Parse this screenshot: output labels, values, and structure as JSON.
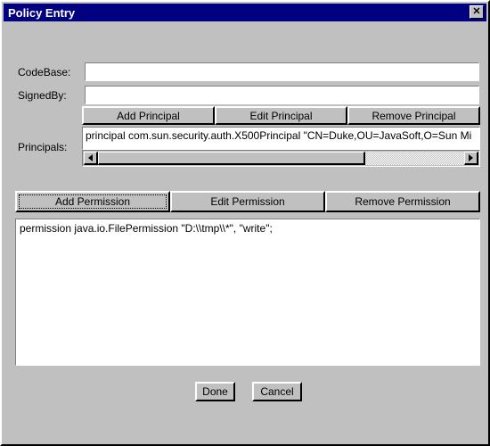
{
  "window": {
    "title": "Policy Entry",
    "close_label": "✕"
  },
  "form": {
    "codebase_label": "CodeBase:",
    "codebase_value": "",
    "codebase_placeholder": "",
    "signedby_label": "SignedBy:",
    "signedby_value": "",
    "signedby_placeholder": "",
    "principals_label": "Principals:"
  },
  "principal_buttons": {
    "add": "Add Principal",
    "edit": "Edit Principal",
    "remove": "Remove Principal"
  },
  "principals_list": [
    "principal com.sun.security.auth.X500Principal \"CN=Duke,OU=JavaSoft,O=Sun Mi"
  ],
  "principals_scrollbar": {
    "left_arrow": "◀",
    "right_arrow": "▶",
    "thumb_percent": 73
  },
  "permission_buttons": {
    "add": "Add Permission",
    "edit": "Edit Permission",
    "remove": "Remove Permission",
    "focused": "add"
  },
  "permissions_list": [
    "permission java.io.FilePermission \"D:\\\\tmp\\\\*\", \"write\";"
  ],
  "footer": {
    "done": "Done",
    "cancel": "Cancel"
  },
  "colors": {
    "titlebar": "#000080",
    "face": "#c0c0c0",
    "field": "#ffffff",
    "text": "#000000"
  }
}
